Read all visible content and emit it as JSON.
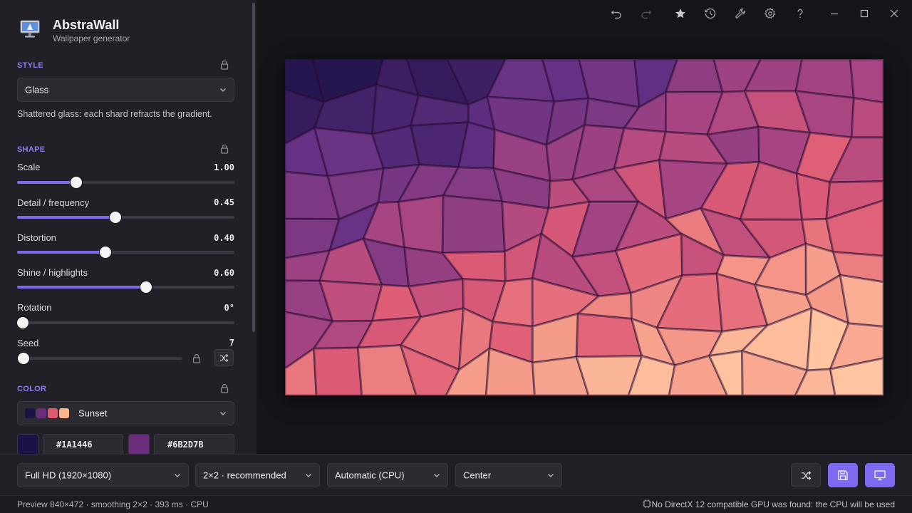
{
  "app": {
    "title": "AbstraWall",
    "subtitle": "Wallpaper generator"
  },
  "style_section": {
    "label": "STYLE",
    "selected": "Glass",
    "description": "Shattered glass: each shard refracts the gradient."
  },
  "shape_section": {
    "label": "SHAPE",
    "sliders": [
      {
        "label": "Scale",
        "value": "1.00",
        "fraction": 0.273
      },
      {
        "label": "Detail / frequency",
        "value": "0.45",
        "fraction": 0.451
      },
      {
        "label": "Distortion",
        "value": "0.40",
        "fraction": 0.405
      },
      {
        "label": "Shine / highlights",
        "value": "0.60",
        "fraction": 0.595
      },
      {
        "label": "Rotation",
        "value": "0°",
        "fraction": 0.0
      }
    ],
    "seed": {
      "label": "Seed",
      "value": "7",
      "fraction": 0.04
    }
  },
  "color_section": {
    "label": "COLOR",
    "palette_name": "Sunset",
    "palette_colors": [
      "#1A1446",
      "#6B2D7B",
      "#E05A6E",
      "#FFB48C"
    ],
    "hex_values": [
      "#1A1446",
      "#6B2D7B"
    ]
  },
  "toolbar": {
    "icons": [
      "undo-icon",
      "redo-icon",
      "star-icon",
      "history-icon",
      "wrench-icon",
      "gear-icon",
      "help-icon",
      "minimize-icon",
      "maximize-icon",
      "close-icon"
    ]
  },
  "bottom_bar": {
    "resolution": "Full HD (1920×1080)",
    "smoothing": "2×2 · recommended",
    "renderer": "Automatic (CPU)",
    "placement": "Center"
  },
  "status": {
    "left": "Preview 840×472 · smoothing 2×2 · 393 ms · CPU",
    "right": "No DirectX 12 compatible GPU was found: the CPU will be used"
  },
  "colors": {
    "accent": "#7C6AF0",
    "background": "#141419",
    "panel": "#202026"
  }
}
